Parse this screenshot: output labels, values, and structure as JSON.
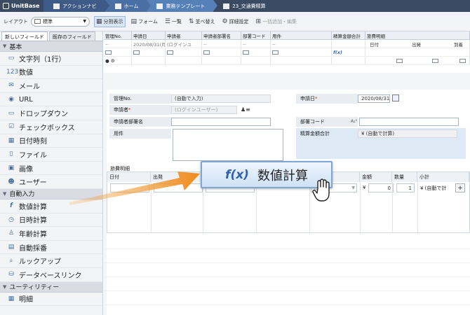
{
  "app": {
    "brand": "UnitBase"
  },
  "breadcrumbs": [
    {
      "label": "アクションナビ"
    },
    {
      "label": "ホーム"
    },
    {
      "label": "業務テンプレート"
    },
    {
      "label": "23_交通費精算"
    }
  ],
  "toolbar": {
    "layout_label": "レイアウト",
    "layout_value": "標準",
    "split_view": "分割表示",
    "form": "フォーム",
    "list": "一覧",
    "sort": "並べ替え",
    "details": "詳細設定",
    "bulk_edit": "一括追加・編集"
  },
  "sidebar": {
    "tabs": [
      "新しいフィールド",
      "既存のフィールド"
    ],
    "sections": [
      {
        "title": "基本",
        "items": [
          {
            "label": "文字列（1行）",
            "icon": "text-line-icon"
          },
          {
            "label": "数値",
            "icon": "number-icon"
          },
          {
            "label": "メール",
            "icon": "mail-icon"
          },
          {
            "label": "URL",
            "icon": "globe-icon"
          },
          {
            "label": "ドロップダウン",
            "icon": "dropdown-icon"
          },
          {
            "label": "チェックボックス",
            "icon": "checkbox-icon"
          },
          {
            "label": "日付時刻",
            "icon": "calendar-icon"
          },
          {
            "label": "ファイル",
            "icon": "file-icon"
          },
          {
            "label": "画像",
            "icon": "image-icon"
          },
          {
            "label": "ユーザー",
            "icon": "user-icon"
          }
        ]
      },
      {
        "title": "自動入力",
        "items": [
          {
            "label": "数値計算",
            "icon": "fx-icon"
          },
          {
            "label": "日時計算",
            "icon": "clock-calc-icon"
          },
          {
            "label": "年齢計算",
            "icon": "age-calc-icon"
          },
          {
            "label": "自動採番",
            "icon": "autonumber-icon"
          },
          {
            "label": "ルックアップ",
            "icon": "lookup-icon"
          },
          {
            "label": "データベースリンク",
            "icon": "db-link-icon"
          }
        ]
      },
      {
        "title": "ユーティリティー",
        "items": [
          {
            "label": "明細",
            "icon": "table-icon"
          }
        ]
      }
    ]
  },
  "grid": {
    "headers": [
      "管理No.",
      "申請日",
      "申請者",
      "申請者部署名",
      "部署コード",
      "用件",
      "精算金額合計",
      "旅費明細"
    ],
    "subheaders": [
      "日付",
      "出発",
      "到着"
    ],
    "row": [
      "--",
      "2020/08/31(月)",
      "(ログインユ",
      "--",
      "--",
      "--",
      "",
      "--"
    ]
  },
  "form": {
    "kanri_label": "管理No.",
    "kanri_value": "(自動で入力)",
    "shinseisha_label": "申請者",
    "shinseisha_value": "(ログインユーザー)",
    "dept_label": "申請者部署名",
    "youken_label": "用件",
    "date_label": "申請日",
    "date_value": "2020/08/31",
    "dept_code_label": "部署コード",
    "total_label": "精算金額合計",
    "total_value": "¥ (自動で計算)"
  },
  "detail": {
    "title": "旅費明細",
    "headers": [
      "日付",
      "出発",
      "金額",
      "数量",
      "小計"
    ],
    "select_placeholder": "ださい",
    "amount": "0",
    "qty": "1",
    "subtotal": "¥ (自動で計",
    "yen": "¥",
    "add": "+"
  },
  "tooltip": {
    "label": "数値計算"
  }
}
